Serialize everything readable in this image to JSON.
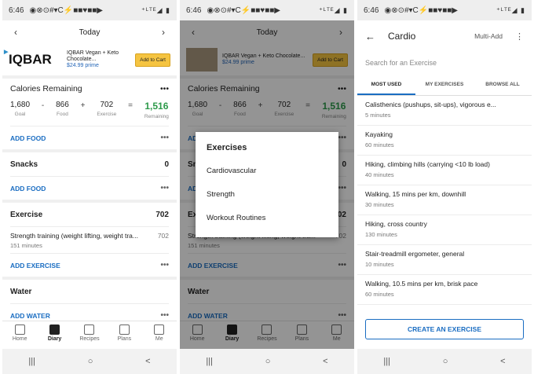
{
  "status": {
    "time": "6:46",
    "icons": "◉⊗⊙#▾C⚡■■♥■■▶",
    "right": "⁺ᴸᵀᴱ◢ ▮"
  },
  "diary": {
    "day_label": "Today",
    "prev_icon": "chevron-left-icon",
    "next_icon": "chevron-right-icon",
    "ad": {
      "brand": "IQBAR",
      "text": "IQBAR Vegan + Keto Chocolate...",
      "price": "$24.99",
      "prime": "prime",
      "cta": "Add to Cart"
    },
    "calories": {
      "title": "Calories Remaining",
      "goal": "1,680",
      "goal_label": "Goal",
      "food": "866",
      "food_label": "Food",
      "exercise": "702",
      "exercise_label": "Exercise",
      "remaining": "1,516",
      "remaining_label": "Remaining",
      "minus": "-",
      "plus": "+",
      "equals": "="
    },
    "add_food": "ADD FOOD",
    "snacks": {
      "title": "Snacks",
      "value": "0",
      "add": "ADD FOOD"
    },
    "exercise": {
      "title": "Exercise",
      "value": "702",
      "item": "Strength training (weight lifting, weight tra...",
      "item_value": "702",
      "item_sub": "151 minutes",
      "add": "ADD EXERCISE"
    },
    "water": {
      "title": "Water",
      "add": "ADD WATER"
    },
    "more_icon": "more-dots-icon"
  },
  "tabs": [
    {
      "label": "Home",
      "icon": "home-icon"
    },
    {
      "label": "Diary",
      "icon": "book-icon"
    },
    {
      "label": "Recipes",
      "icon": "recipes-icon"
    },
    {
      "label": "Plans",
      "icon": "plans-icon"
    },
    {
      "label": "Me",
      "icon": "person-icon"
    }
  ],
  "navbar": {
    "recents": "|||",
    "home": "○",
    "back": "<"
  },
  "dialog": {
    "title": "Exercises",
    "items": [
      "Cardiovascular",
      "Strength",
      "Workout Routines"
    ]
  },
  "cardio": {
    "title": "Cardio",
    "multi_add": "Multi-Add",
    "search_placeholder": "Search for an Exercise",
    "tabs": [
      "MOST USED",
      "MY EXERCISES",
      "BROWSE ALL"
    ],
    "exercises": [
      {
        "name": "Calisthenics (pushups, sit-ups), vigorous e...",
        "sub": "5 minutes"
      },
      {
        "name": "Kayaking",
        "sub": "60 minutes"
      },
      {
        "name": "Hiking, climbing hills (carrying <10 lb load)",
        "sub": "40 minutes"
      },
      {
        "name": "Walking, 15 mins per km, downhill",
        "sub": "30 minutes"
      },
      {
        "name": "Hiking, cross country",
        "sub": "130 minutes"
      },
      {
        "name": "Stair-treadmill ergometer, general",
        "sub": "10 minutes"
      },
      {
        "name": "Walking, 10.5 mins per km, brisk pace",
        "sub": "60 minutes"
      }
    ],
    "create": "CREATE AN EXERCISE"
  }
}
